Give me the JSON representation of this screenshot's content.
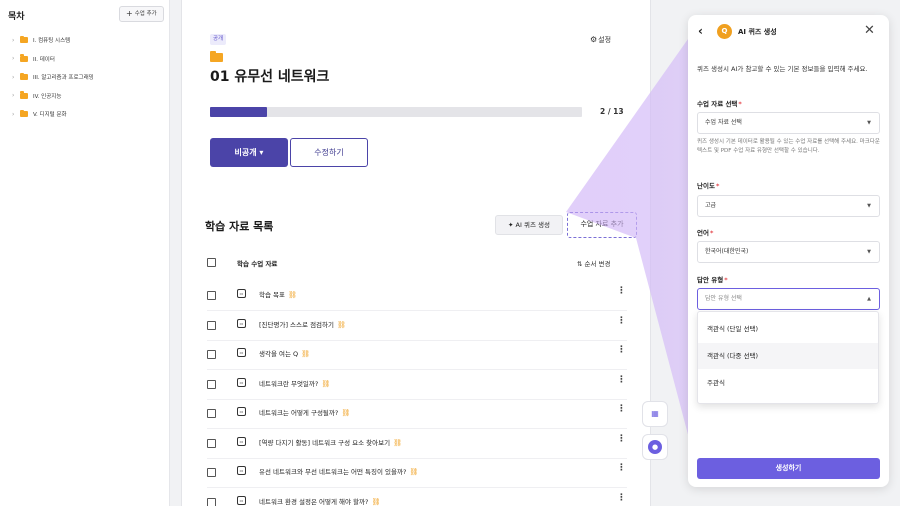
{
  "sidebar": {
    "title": "목차",
    "add_label": "수업 추가",
    "items": [
      {
        "label": "I. 컴퓨팅 시스템"
      },
      {
        "label": "II. 데이터"
      },
      {
        "label": "III. 알고리즘과 프로그래밍"
      },
      {
        "label": "IV. 인공지능"
      },
      {
        "label": "V. 디지털 문화"
      }
    ]
  },
  "main": {
    "tag": "공개",
    "settings_label": "설정",
    "title": "01 유무선 네트워크",
    "progress": {
      "current": 2,
      "total": 13,
      "label": "2 / 13"
    },
    "private_button": "비공개 ▾",
    "edit_button": "수정하기",
    "section_title": "학습 자료 목록",
    "ai_quiz_button": "AI 퀴즈 생성",
    "add_material_button": "수업 자료 추가",
    "list_header": "학습 수업 자료",
    "sort_label": "순서 변경",
    "rows": [
      {
        "text": "학습 목표"
      },
      {
        "text": "[진단평가] 스스로 점검하기"
      },
      {
        "text": "생각을 여는 Q"
      },
      {
        "text": "네트워크란 무엇일까?"
      },
      {
        "text": "네트워크는 어떻게 구성될까?"
      },
      {
        "text": "[역량 다지기 활동] 네트워크 구성 요소 찾아보기"
      },
      {
        "text": "유선 네트워크와 무선 네트워크는 어떤 특징이 있을까?"
      },
      {
        "text": "네트워크 환경 설정은 어떻게 해야 할까?"
      }
    ]
  },
  "panel": {
    "title": "AI 퀴즈 생성",
    "description": "퀴즈 생성시 AI가 참고할 수 있는 기본 정보들을 입력해 주세요.",
    "material_label": "수업 자료 선택",
    "material_value": "수업 자료 선택",
    "material_help": "퀴즈 생성시 기본 데이터로 활용될 수 있는 수업 자료를 선택해 주세요. 마크다운 텍스트 및 PDF 수업 자료 유형만 선택할 수 있습니다.",
    "difficulty_label": "난이도",
    "difficulty_value": "고급",
    "language_label": "언어",
    "language_value": "한국어(대한민국)",
    "answer_type_label": "답안 유형",
    "answer_type_placeholder": "답안 유형 선택",
    "answer_options": [
      "객관식 (단일 선택)",
      "객관식 (다중 선택)",
      "주관식"
    ],
    "generate_button": "생성하기"
  },
  "colors": {
    "accent": "#6c5fe0",
    "primary_dark": "#4b44a8",
    "folder": "#f5a623"
  }
}
